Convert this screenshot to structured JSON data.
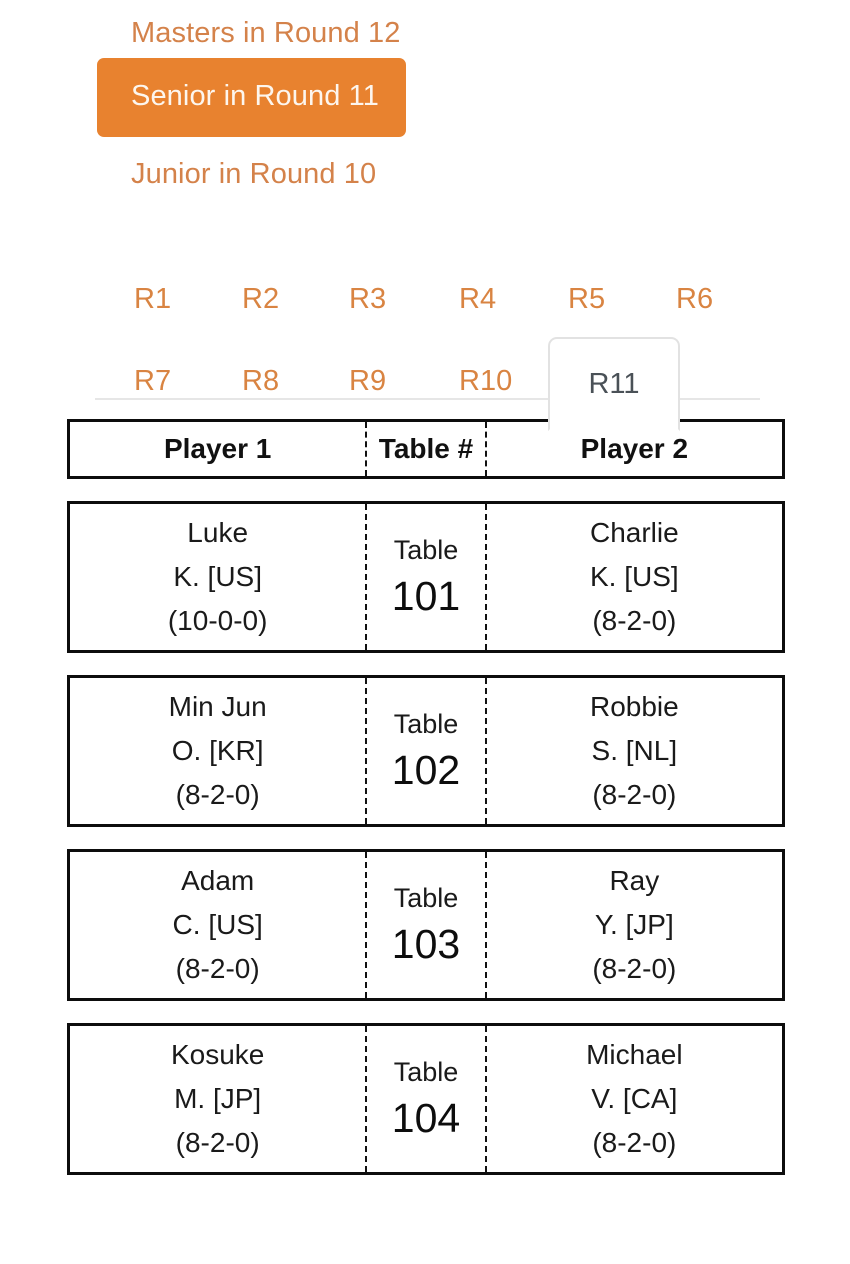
{
  "divisions": [
    {
      "label": "Masters in Round 12",
      "active": false,
      "name": "division-link-masters"
    },
    {
      "label": "Senior in Round 11",
      "active": true,
      "name": "division-link-senior"
    },
    {
      "label": "Junior in Round 10",
      "active": false,
      "name": "division-link-junior"
    }
  ],
  "colors": {
    "accent_orange": "#e8822f",
    "link_orange": "#d4824a",
    "active_tab_text": "#4a5157",
    "table_border": "#0d0d0d"
  },
  "rounds": {
    "tabs": [
      {
        "label": "R1",
        "active": false
      },
      {
        "label": "R2",
        "active": false
      },
      {
        "label": "R3",
        "active": false
      },
      {
        "label": "R4",
        "active": false
      },
      {
        "label": "R5",
        "active": false
      },
      {
        "label": "R6",
        "active": false
      },
      {
        "label": "R7",
        "active": false
      },
      {
        "label": "R8",
        "active": false
      },
      {
        "label": "R9",
        "active": false
      },
      {
        "label": "R10",
        "active": false
      },
      {
        "label": "R11",
        "active": true
      }
    ],
    "selected": "R11"
  },
  "table": {
    "headers": {
      "player1": "Player 1",
      "table": "Table #",
      "player2": "Player 2"
    },
    "table_label": "Table",
    "rows": [
      {
        "table_number": "101",
        "player1": {
          "first_name": "Luke",
          "initial_country": "K. [US]",
          "record": "(10-0-0)"
        },
        "player2": {
          "first_name": "Charlie",
          "initial_country": "K. [US]",
          "record": "(8-2-0)"
        }
      },
      {
        "table_number": "102",
        "player1": {
          "first_name": "Min Jun",
          "initial_country": "O. [KR]",
          "record": "(8-2-0)"
        },
        "player2": {
          "first_name": "Robbie",
          "initial_country": "S. [NL]",
          "record": "(8-2-0)"
        }
      },
      {
        "table_number": "103",
        "player1": {
          "first_name": "Adam",
          "initial_country": "C. [US]",
          "record": "(8-2-0)"
        },
        "player2": {
          "first_name": "Ray",
          "initial_country": "Y. [JP]",
          "record": "(8-2-0)"
        }
      },
      {
        "table_number": "104",
        "player1": {
          "first_name": "Kosuke",
          "initial_country": "M. [JP]",
          "record": "(8-2-0)"
        },
        "player2": {
          "first_name": "Michael",
          "initial_country": "V. [CA]",
          "record": "(8-2-0)"
        }
      }
    ]
  }
}
